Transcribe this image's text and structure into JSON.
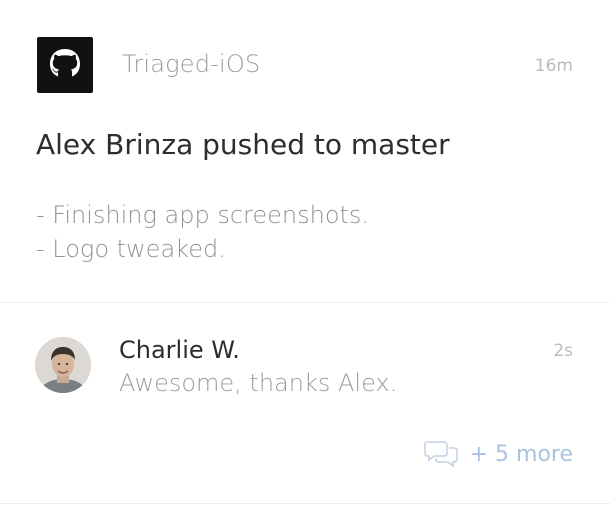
{
  "push_card": {
    "repo_icon": "github-octocat-icon",
    "repo_name": "Triaged-iOS",
    "time": "16m",
    "title": "Alex Brinza pushed to master",
    "commits": [
      "- Finishing app screenshots.",
      "- Logo tweaked."
    ]
  },
  "comment_card": {
    "avatar_icon": "user-avatar",
    "author": "Charlie W.",
    "time": "2s",
    "text": "Awesome, thanks Alex.",
    "more_icon": "chat-bubbles-icon",
    "more_label": "+ 5 more"
  },
  "colors": {
    "title": "#2b2d31",
    "muted": "#9a9ca3",
    "timestamp": "#b9bcc2",
    "link": "#a9c3e0",
    "icon_bg": "#111111",
    "divider": "#ececec"
  }
}
